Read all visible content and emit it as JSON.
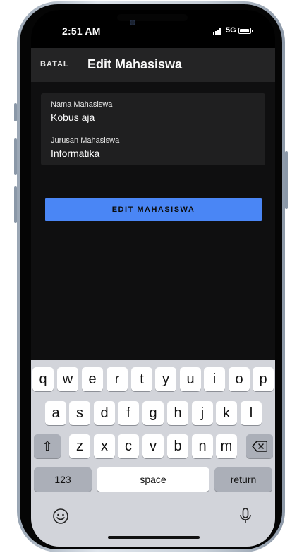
{
  "status_bar": {
    "time": "2:51 AM",
    "network": "5G"
  },
  "app_bar": {
    "cancel_label": "BATAL",
    "title": "Edit Mahasiswa"
  },
  "form": {
    "nama": {
      "label": "Nama Mahasiswa",
      "value": "Kobus aja"
    },
    "jurusan": {
      "label": "Jurusan Mahasiswa",
      "value": "Informatika"
    }
  },
  "submit_label": "EDIT MAHASISWA",
  "keyboard": {
    "row1": [
      "q",
      "w",
      "e",
      "r",
      "t",
      "y",
      "u",
      "i",
      "o",
      "p"
    ],
    "row2": [
      "a",
      "s",
      "d",
      "f",
      "g",
      "h",
      "j",
      "k",
      "l"
    ],
    "row3": [
      "z",
      "x",
      "c",
      "v",
      "b",
      "n",
      "m"
    ],
    "numbers_label": "123",
    "space_label": "space",
    "return_label": "return"
  },
  "icons": {
    "shift": "shift-icon",
    "backspace": "backspace-icon",
    "emoji": "emoji-icon",
    "mic": "microphone-icon"
  },
  "colors": {
    "accent": "#4a86f5",
    "app_bar": "#242425",
    "background": "#0f0f10"
  }
}
